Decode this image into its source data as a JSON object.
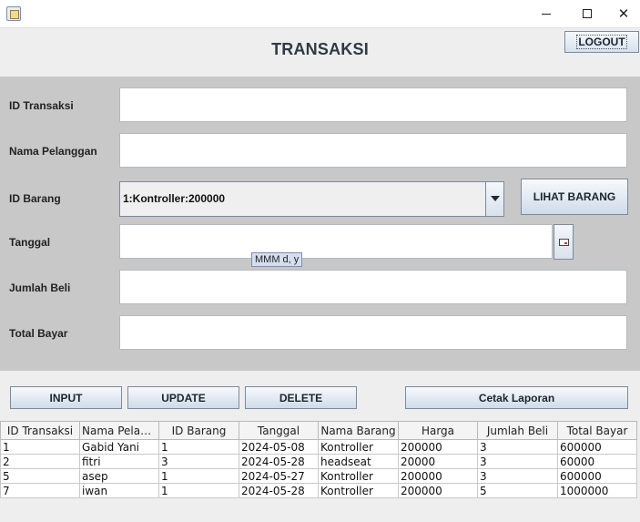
{
  "window": {
    "minimize_icon": "minimize-icon",
    "maximize_icon": "maximize-icon",
    "close_glyph": "✕"
  },
  "header": {
    "title": "TRANSAKSI",
    "logout_label": "LOGOUT"
  },
  "form": {
    "id_transaksi_label": "ID Transaksi",
    "id_transaksi_value": "",
    "nama_pelanggan_label": "Nama Pelanggan",
    "nama_pelanggan_value": "",
    "id_barang_label": "ID Barang",
    "id_barang_selected": "1:Kontroller:200000",
    "lihat_barang_label": "LIHAT BARANG",
    "tanggal_label": "Tanggal",
    "tanggal_value": "",
    "tanggal_tooltip": "MMM d, y",
    "jumlah_beli_label": "Jumlah Beli",
    "jumlah_beli_value": "",
    "total_bayar_label": "Total Bayar",
    "total_bayar_value": ""
  },
  "actions": {
    "input_label": "INPUT",
    "update_label": "UPDATE",
    "delete_label": "DELETE",
    "cetak_label": "Cetak Laporan"
  },
  "table": {
    "columns": [
      "ID Transaksi",
      "Nama Pelang...",
      "ID Barang",
      "Tanggal",
      "Nama Barang",
      "Harga",
      "Jumlah Beli",
      "Total Bayar"
    ],
    "rows": [
      [
        "1",
        "Gabid Yani",
        "1",
        "2024-05-08",
        "Kontroller",
        "200000",
        "3",
        "600000"
      ],
      [
        "2",
        "fitri",
        "3",
        "2024-05-28",
        "headseat",
        "20000",
        "3",
        "60000"
      ],
      [
        "5",
        "asep",
        "1",
        "2024-05-27",
        "Kontroller",
        "200000",
        "3",
        "600000"
      ],
      [
        "7",
        "iwan",
        "1",
        "2024-05-28",
        "Kontroller",
        "200000",
        "5",
        "1000000"
      ]
    ]
  }
}
